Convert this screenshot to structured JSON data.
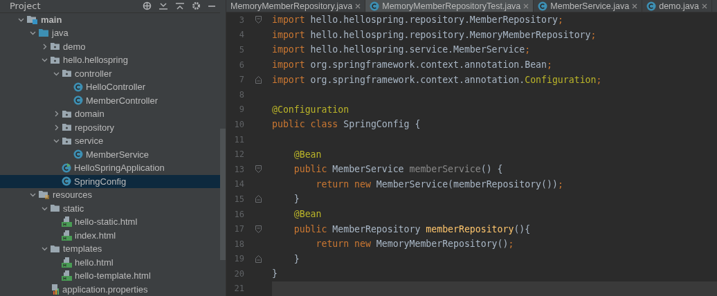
{
  "project_panel": {
    "title": "Project",
    "tree": [
      {
        "label": "main",
        "kind": "module",
        "expanded": true,
        "selected": false,
        "children": [
          {
            "label": "java",
            "kind": "source",
            "expanded": true,
            "selected": false,
            "children": [
              {
                "label": "demo",
                "kind": "package",
                "expanded": false,
                "selected": false
              },
              {
                "label": "hello.hellospring",
                "kind": "package",
                "expanded": true,
                "selected": false,
                "children": [
                  {
                    "label": "controller",
                    "kind": "package",
                    "expanded": true,
                    "selected": false,
                    "children": [
                      {
                        "label": "HelloController",
                        "kind": "class",
                        "selected": false
                      },
                      {
                        "label": "MemberController",
                        "kind": "class",
                        "selected": false
                      }
                    ]
                  },
                  {
                    "label": "domain",
                    "kind": "package",
                    "expanded": false,
                    "selected": false
                  },
                  {
                    "label": "repository",
                    "kind": "package",
                    "expanded": false,
                    "selected": false
                  },
                  {
                    "label": "service",
                    "kind": "package",
                    "expanded": true,
                    "selected": false,
                    "children": [
                      {
                        "label": "MemberService",
                        "kind": "class",
                        "selected": false
                      }
                    ]
                  },
                  {
                    "label": "HelloSpringApplication",
                    "kind": "app",
                    "selected": false
                  },
                  {
                    "label": "SpringConfig",
                    "kind": "class",
                    "selected": true
                  }
                ]
              }
            ]
          },
          {
            "label": "resources",
            "kind": "resources",
            "expanded": true,
            "selected": false,
            "children": [
              {
                "label": "static",
                "kind": "folder",
                "expanded": true,
                "selected": false,
                "children": [
                  {
                    "label": "hello-static.html",
                    "kind": "html",
                    "selected": false
                  },
                  {
                    "label": "index.html",
                    "kind": "html",
                    "selected": false
                  }
                ]
              },
              {
                "label": "templates",
                "kind": "folder",
                "expanded": true,
                "selected": false,
                "children": [
                  {
                    "label": "hello.html",
                    "kind": "html",
                    "selected": false
                  },
                  {
                    "label": "hello-template.html",
                    "kind": "html",
                    "selected": false
                  }
                ]
              },
              {
                "label": "application.properties",
                "kind": "properties",
                "selected": false
              }
            ]
          }
        ]
      }
    ]
  },
  "editor": {
    "tabs": [
      {
        "label": "MemoryMemberRepository.java",
        "icon": false,
        "selected": false
      },
      {
        "label": "MemoryMemberRepositoryTest.java",
        "icon": true,
        "selected": true
      },
      {
        "label": "MemberService.java",
        "icon": true,
        "selected": false
      },
      {
        "label": "demo.java",
        "icon": true,
        "selected": false
      }
    ],
    "lines": [
      {
        "number": "3",
        "kind": "fold-start",
        "current": false,
        "tokens": [
          {
            "text": "import",
            "kind": "keyword"
          },
          {
            "text": " hello.hellospring.repository.MemberRepository",
            "kind": "plain"
          },
          {
            "text": ";",
            "kind": "keyword"
          }
        ]
      },
      {
        "number": "4",
        "kind": "plain",
        "current": false,
        "tokens": [
          {
            "text": "import",
            "kind": "keyword"
          },
          {
            "text": " hello.hellospring.repository.MemoryMemberRepository",
            "kind": "plain"
          },
          {
            "text": ";",
            "kind": "keyword"
          }
        ]
      },
      {
        "number": "5",
        "kind": "plain",
        "current": false,
        "tokens": [
          {
            "text": "import",
            "kind": "keyword"
          },
          {
            "text": " hello.hellospring.service.MemberService",
            "kind": "plain"
          },
          {
            "text": ";",
            "kind": "keyword"
          }
        ]
      },
      {
        "number": "6",
        "kind": "plain",
        "current": false,
        "tokens": [
          {
            "text": "import",
            "kind": "keyword"
          },
          {
            "text": " org.springframework.context.annotation.Bean",
            "kind": "plain"
          },
          {
            "text": ";",
            "kind": "keyword"
          }
        ]
      },
      {
        "number": "7",
        "kind": "fold-end",
        "current": false,
        "tokens": [
          {
            "text": "import",
            "kind": "keyword"
          },
          {
            "text": " org.springframework.context.annotation.",
            "kind": "plain"
          },
          {
            "text": "Configuration",
            "kind": "annotation"
          },
          {
            "text": ";",
            "kind": "keyword"
          }
        ]
      },
      {
        "number": "8",
        "kind": "plain",
        "current": false
      },
      {
        "number": "9",
        "kind": "plain",
        "current": false,
        "tokens": [
          {
            "text": "@Configuration",
            "kind": "annotation"
          }
        ]
      },
      {
        "number": "10",
        "kind": "plain",
        "current": false,
        "tokens": [
          {
            "text": "public class",
            "kind": "keyword"
          },
          {
            "text": " SpringConfig {",
            "kind": "plain"
          }
        ]
      },
      {
        "number": "11",
        "kind": "plain",
        "current": false
      },
      {
        "number": "12",
        "kind": "plain",
        "current": false,
        "tokens": [
          {
            "text": "    @Bean",
            "kind": "annotation"
          }
        ]
      },
      {
        "number": "13",
        "kind": "fold-start",
        "current": false,
        "tokens": [
          {
            "text": "    public",
            "kind": "keyword"
          },
          {
            "text": " MemberService ",
            "kind": "plain"
          },
          {
            "text": "memberService",
            "kind": "unused"
          },
          {
            "text": "() {",
            "kind": "plain"
          }
        ]
      },
      {
        "number": "14",
        "kind": "plain",
        "current": false,
        "tokens": [
          {
            "text": "        return new",
            "kind": "keyword"
          },
          {
            "text": " MemberService(memberRepository())",
            "kind": "plain"
          },
          {
            "text": ";",
            "kind": "keyword"
          }
        ]
      },
      {
        "number": "15",
        "kind": "fold-end",
        "current": false,
        "tokens": [
          {
            "text": "    }",
            "kind": "plain"
          }
        ]
      },
      {
        "number": "16",
        "kind": "plain",
        "current": false,
        "tokens": [
          {
            "text": "    @Bean",
            "kind": "annotation"
          }
        ]
      },
      {
        "number": "17",
        "kind": "fold-start",
        "current": false,
        "tokens": [
          {
            "text": "    public",
            "kind": "keyword"
          },
          {
            "text": " MemberRepository ",
            "kind": "plain"
          },
          {
            "text": "memberRepository",
            "kind": "method"
          },
          {
            "text": "(){",
            "kind": "plain"
          }
        ]
      },
      {
        "number": "18",
        "kind": "plain",
        "current": false,
        "tokens": [
          {
            "text": "        return new",
            "kind": "keyword"
          },
          {
            "text": " MemoryMemberRepository()",
            "kind": "plain"
          },
          {
            "text": ";",
            "kind": "keyword"
          }
        ]
      },
      {
        "number": "19",
        "kind": "fold-end",
        "current": false,
        "tokens": [
          {
            "text": "    }",
            "kind": "plain"
          }
        ]
      },
      {
        "number": "20",
        "kind": "plain",
        "current": false,
        "tokens": [
          {
            "text": "}",
            "kind": "plain"
          }
        ]
      },
      {
        "number": "21",
        "kind": "plain",
        "current": true
      }
    ]
  }
}
